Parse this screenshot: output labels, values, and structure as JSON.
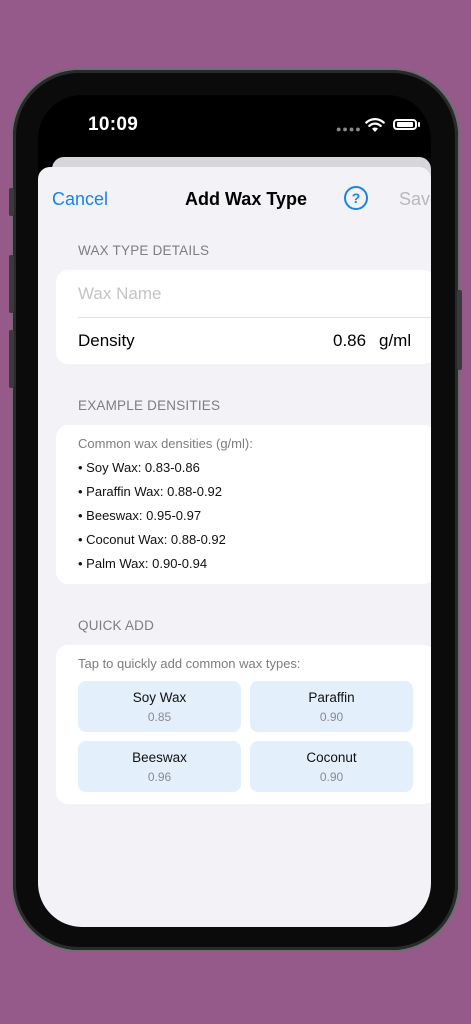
{
  "status": {
    "time": "10:09"
  },
  "nav": {
    "cancel": "Cancel",
    "title": "Add Wax Type",
    "help": "?",
    "save": "Save"
  },
  "details": {
    "header": "WAX TYPE DETAILS",
    "name_placeholder": "Wax Name",
    "density_label": "Density",
    "density_value": "0.86",
    "density_unit": "g/ml"
  },
  "examples": {
    "header": "EXAMPLE DENSITIES",
    "note": "Common wax densities (g/ml):",
    "items": [
      "• Soy Wax: 0.83-0.86",
      "• Paraffin Wax: 0.88-0.92",
      "• Beeswax: 0.95-0.97",
      "• Coconut Wax: 0.88-0.92",
      "• Palm Wax: 0.90-0.94"
    ]
  },
  "quick_add": {
    "header": "QUICK ADD",
    "note": "Tap to quickly add common wax types:",
    "items": [
      {
        "name": "Soy Wax",
        "value": "0.85"
      },
      {
        "name": "Paraffin",
        "value": "0.90"
      },
      {
        "name": "Beeswax",
        "value": "0.96"
      },
      {
        "name": "Coconut",
        "value": "0.90"
      }
    ]
  },
  "colors": {
    "background": "#955a89",
    "accent": "#1a84e0",
    "tile": "#e4effc"
  }
}
